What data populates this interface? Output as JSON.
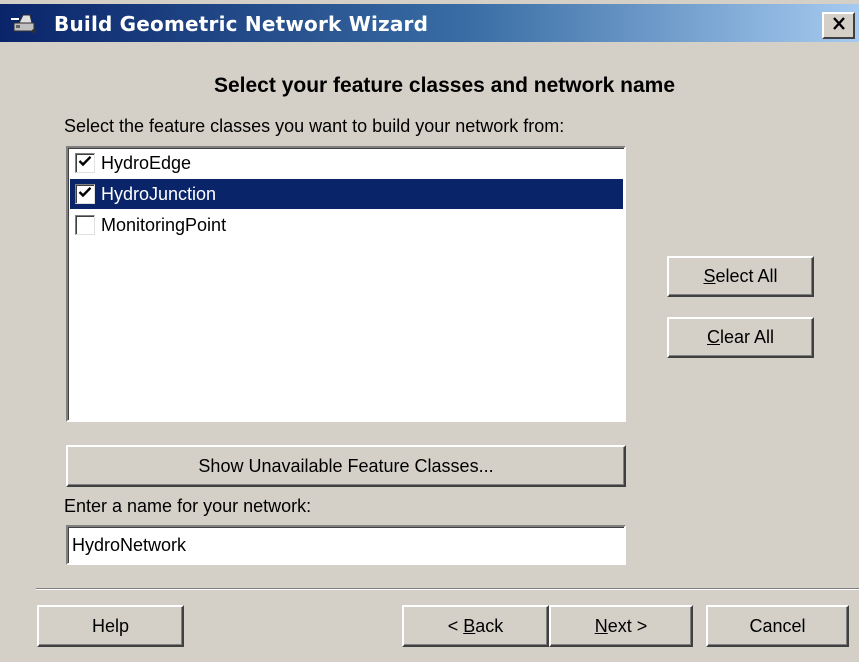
{
  "window": {
    "title": "Build Geometric Network Wizard",
    "close_glyph": "✕"
  },
  "heading": "Select your feature classes and network name",
  "instructions": "Select the feature classes you want to build your network from:",
  "feature_classes": [
    {
      "label": "HydroEdge",
      "checked": true,
      "selected": false
    },
    {
      "label": "HydroJunction",
      "checked": true,
      "selected": true
    },
    {
      "label": "MonitoringPoint",
      "checked": false,
      "selected": false
    }
  ],
  "buttons": {
    "select_all": {
      "prefix": "",
      "mnemonic": "S",
      "rest": "elect All"
    },
    "clear_all": {
      "prefix": "",
      "mnemonic": "C",
      "rest": "lear All"
    },
    "show_unavailable": "Show Unavailable Feature Classes...",
    "help": "Help",
    "back": {
      "prefix": "< ",
      "mnemonic": "B",
      "rest": "ack"
    },
    "next": {
      "prefix": "",
      "mnemonic": "N",
      "rest": "ext >"
    },
    "cancel": "Cancel"
  },
  "network_name": {
    "label": "Enter a name for your network:",
    "value": "HydroNetwork"
  },
  "colors": {
    "selection": "#0a246a",
    "face": "#d4d0c8",
    "title_gradient_start": "#0a246a",
    "title_gradient_end": "#a6caf0"
  },
  "icons": {
    "app": "network-wizard-icon",
    "close": "close-icon",
    "checkbox": "checkmark-icon"
  }
}
